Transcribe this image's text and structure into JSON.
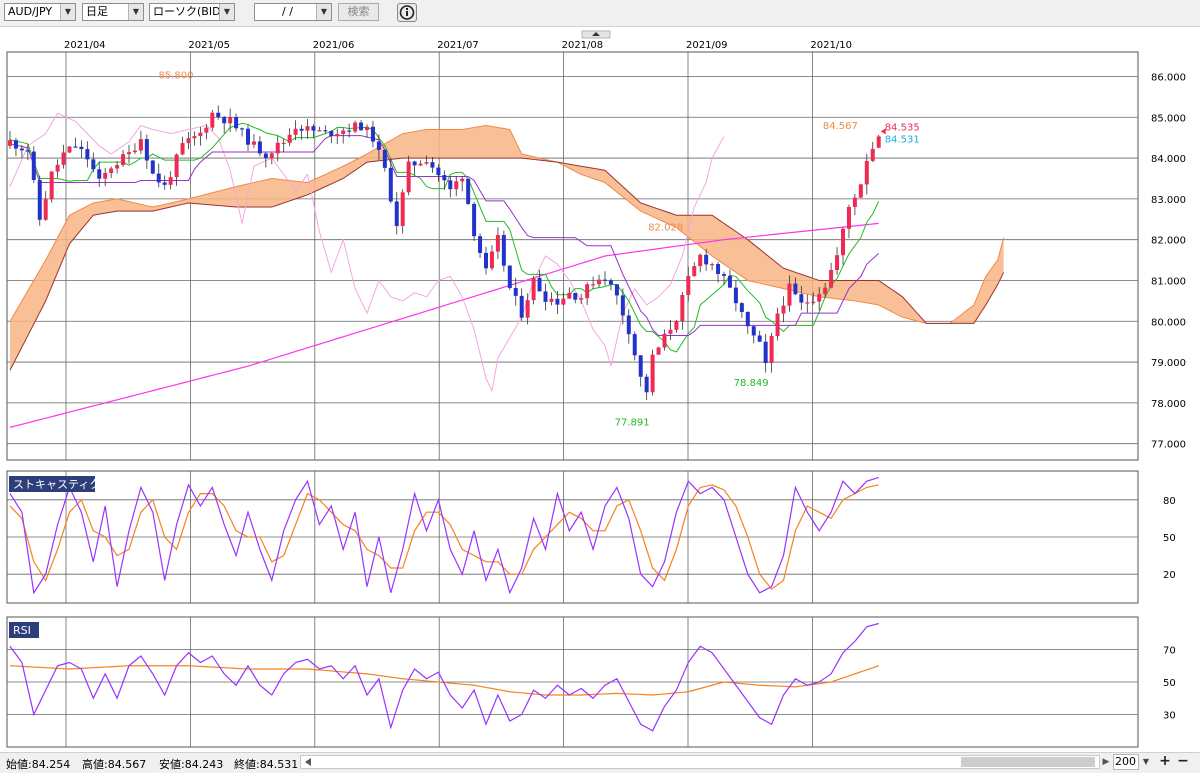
{
  "toolbar": {
    "symbol": "AUD/JPY",
    "timeframe": "日足",
    "chart_kind": "ローソク(BID)",
    "date": "/ /",
    "search_label": "検索",
    "info_icon": "info-icon"
  },
  "status": {
    "open": "始値:84.254",
    "high": "高値:84.567",
    "low": "安値:84.243",
    "close": "終値:84.531",
    "zoom": "200"
  },
  "panels": {
    "stoch_label": "ストキャスティクス",
    "rsi_label": "RSI"
  },
  "colors": {
    "up": "#ee2a55",
    "down": "#2233cc",
    "cloud": "#f8b484",
    "ma200": "#ff33ee",
    "tenkan": "#22bb22",
    "kijun": "#9933cc",
    "chikou": "#f5a6e0",
    "span_a": "#f08a48",
    "span_b": "#993333",
    "stoch_k": "#9933ff",
    "stoch_d": "#f58220"
  },
  "chart_data": {
    "type": "candlestick",
    "x_axis": {
      "labels": [
        "2021/04",
        "2021/05",
        "2021/06",
        "2021/07",
        "2021/08",
        "2021/09",
        "2021/10"
      ]
    },
    "price_axis": {
      "ticks": [
        "86.000",
        "85.000",
        "84.000",
        "83.000",
        "82.000",
        "81.000",
        "80.000",
        "79.000",
        "78.000",
        "77.000"
      ],
      "ylim": [
        76.6,
        86.6
      ]
    },
    "annotations": [
      {
        "text": "85.800",
        "color": "#f08a48",
        "x_index": 31,
        "value": 85.8
      },
      {
        "text": "82.028",
        "color": "#f08a48",
        "x_index": 116,
        "value": 82.03
      },
      {
        "text": "77.891",
        "color": "#22bb22",
        "x_index": 107,
        "value": 77.89
      },
      {
        "text": "78.849",
        "color": "#22bb22",
        "x_index": 127,
        "value": 78.85
      },
      {
        "text": "84.567",
        "color": "#f08a48",
        "x_index": 143,
        "value": 84.567
      },
      {
        "text": "84.535",
        "color": "#ee2a55",
        "x_index": 146,
        "value": 84.535
      },
      {
        "text": "84.531",
        "color": "#22aadd",
        "x_index": 146,
        "value": 84.531
      }
    ],
    "last": {
      "open": 84.254,
      "high": 84.567,
      "low": 84.243,
      "close": 84.531
    },
    "stoch_axis": {
      "ticks": [
        "80",
        "50",
        "20"
      ],
      "ylim": [
        0,
        100
      ]
    },
    "rsi_axis": {
      "ticks": [
        "70",
        "50",
        "30"
      ],
      "ylim": [
        10,
        90
      ]
    },
    "close_waypoints": [
      [
        0,
        84.4
      ],
      [
        3,
        84.2
      ],
      [
        5,
        82.5
      ],
      [
        7,
        83.6
      ],
      [
        9,
        84.1
      ],
      [
        11,
        84.3
      ],
      [
        13,
        84.0
      ],
      [
        15,
        83.4
      ],
      [
        17,
        83.8
      ],
      [
        20,
        84.1
      ],
      [
        22,
        84.5
      ],
      [
        24,
        83.6
      ],
      [
        26,
        83.3
      ],
      [
        29,
        84.3
      ],
      [
        32,
        84.6
      ],
      [
        34,
        85.1
      ],
      [
        37,
        84.9
      ],
      [
        39,
        84.6
      ],
      [
        41,
        84.3
      ],
      [
        43,
        84.1
      ],
      [
        46,
        84.4
      ],
      [
        48,
        84.8
      ],
      [
        50,
        84.7
      ],
      [
        53,
        84.6
      ],
      [
        56,
        84.7
      ],
      [
        59,
        84.8
      ],
      [
        61,
        84.5
      ],
      [
        63,
        83.7
      ],
      [
        65,
        82.4
      ],
      [
        67,
        83.8
      ],
      [
        70,
        84.0
      ],
      [
        72,
        83.6
      ],
      [
        74,
        83.2
      ],
      [
        76,
        83.6
      ],
      [
        78,
        82.2
      ],
      [
        80,
        81.2
      ],
      [
        82,
        82.0
      ],
      [
        84,
        80.8
      ],
      [
        86,
        80.2
      ],
      [
        88,
        81.0
      ],
      [
        90,
        80.6
      ],
      [
        92,
        80.5
      ],
      [
        94,
        80.7
      ],
      [
        96,
        80.6
      ],
      [
        98,
        81.0
      ],
      [
        100,
        81.1
      ],
      [
        102,
        80.6
      ],
      [
        104,
        79.8
      ],
      [
        106,
        78.6
      ],
      [
        107,
        78.3
      ],
      [
        108,
        79.1
      ],
      [
        110,
        79.6
      ],
      [
        112,
        80.1
      ],
      [
        114,
        81.0
      ],
      [
        116,
        81.6
      ],
      [
        118,
        81.4
      ],
      [
        120,
        81.0
      ],
      [
        122,
        80.5
      ],
      [
        124,
        79.8
      ],
      [
        126,
        79.4
      ],
      [
        127,
        78.9
      ],
      [
        129,
        80.2
      ],
      [
        131,
        80.8
      ],
      [
        133,
        80.4
      ],
      [
        135,
        80.6
      ],
      [
        137,
        80.9
      ],
      [
        139,
        81.6
      ],
      [
        141,
        82.8
      ],
      [
        143,
        83.4
      ],
      [
        144,
        84.0
      ],
      [
        146,
        84.531
      ]
    ],
    "ma200_waypoints": [
      [
        0,
        77.4
      ],
      [
        40,
        78.9
      ],
      [
        80,
        80.7
      ],
      [
        100,
        81.6
      ],
      [
        120,
        82.0
      ],
      [
        146,
        82.4
      ]
    ],
    "cloud_a_waypoints": [
      [
        0,
        80.0
      ],
      [
        6,
        81.5
      ],
      [
        10,
        82.6
      ],
      [
        14,
        82.9
      ],
      [
        18,
        83.0
      ],
      [
        24,
        82.8
      ],
      [
        30,
        83.0
      ],
      [
        38,
        83.3
      ],
      [
        44,
        83.5
      ],
      [
        50,
        83.4
      ],
      [
        56,
        83.8
      ],
      [
        60,
        84.1
      ],
      [
        66,
        84.6
      ],
      [
        70,
        84.7
      ],
      [
        76,
        84.7
      ],
      [
        80,
        84.8
      ],
      [
        84,
        84.7
      ],
      [
        86,
        84.1
      ],
      [
        92,
        83.9
      ],
      [
        96,
        83.6
      ],
      [
        100,
        83.4
      ],
      [
        106,
        82.7
      ],
      [
        112,
        82.3
      ],
      [
        118,
        81.6
      ],
      [
        124,
        81.0
      ],
      [
        130,
        80.8
      ],
      [
        136,
        80.6
      ],
      [
        142,
        80.5
      ],
      [
        146,
        80.4
      ],
      [
        150,
        80.1
      ],
      [
        154,
        79.95
      ],
      [
        158,
        79.95
      ],
      [
        162,
        80.4
      ],
      [
        164,
        81.1
      ],
      [
        166,
        81.5
      ],
      [
        167,
        82.05
      ]
    ],
    "cloud_b_waypoints": [
      [
        0,
        78.8
      ],
      [
        6,
        80.5
      ],
      [
        10,
        81.9
      ],
      [
        14,
        82.6
      ],
      [
        18,
        82.7
      ],
      [
        24,
        82.7
      ],
      [
        30,
        82.9
      ],
      [
        38,
        82.8
      ],
      [
        44,
        82.8
      ],
      [
        50,
        83.1
      ],
      [
        56,
        83.5
      ],
      [
        60,
        83.9
      ],
      [
        66,
        84.0
      ],
      [
        70,
        84.0
      ],
      [
        76,
        84.0
      ],
      [
        80,
        84.0
      ],
      [
        84,
        84.0
      ],
      [
        86,
        84.0
      ],
      [
        92,
        83.9
      ],
      [
        96,
        83.8
      ],
      [
        100,
        83.7
      ],
      [
        106,
        82.9
      ],
      [
        112,
        82.6
      ],
      [
        118,
        82.6
      ],
      [
        124,
        82.0
      ],
      [
        130,
        81.3
      ],
      [
        136,
        81.0
      ],
      [
        142,
        81.0
      ],
      [
        146,
        81.0
      ],
      [
        150,
        80.6
      ],
      [
        154,
        79.95
      ],
      [
        158,
        79.95
      ],
      [
        162,
        79.95
      ],
      [
        164,
        80.4
      ],
      [
        166,
        80.9
      ],
      [
        167,
        81.2
      ]
    ],
    "stoch_k_waypoints": [
      [
        0,
        85
      ],
      [
        2,
        70
      ],
      [
        4,
        5
      ],
      [
        6,
        20
      ],
      [
        8,
        60
      ],
      [
        10,
        90
      ],
      [
        12,
        70
      ],
      [
        14,
        30
      ],
      [
        16,
        75
      ],
      [
        18,
        10
      ],
      [
        20,
        55
      ],
      [
        22,
        90
      ],
      [
        24,
        70
      ],
      [
        26,
        15
      ],
      [
        28,
        60
      ],
      [
        30,
        92
      ],
      [
        32,
        75
      ],
      [
        34,
        90
      ],
      [
        36,
        60
      ],
      [
        38,
        35
      ],
      [
        40,
        70
      ],
      [
        42,
        40
      ],
      [
        44,
        15
      ],
      [
        46,
        55
      ],
      [
        48,
        80
      ],
      [
        50,
        95
      ],
      [
        52,
        60
      ],
      [
        54,
        75
      ],
      [
        56,
        40
      ],
      [
        58,
        70
      ],
      [
        60,
        10
      ],
      [
        62,
        50
      ],
      [
        64,
        5
      ],
      [
        66,
        40
      ],
      [
        68,
        85
      ],
      [
        70,
        55
      ],
      [
        72,
        80
      ],
      [
        74,
        40
      ],
      [
        76,
        20
      ],
      [
        78,
        55
      ],
      [
        80,
        15
      ],
      [
        82,
        40
      ],
      [
        84,
        5
      ],
      [
        86,
        25
      ],
      [
        88,
        65
      ],
      [
        90,
        40
      ],
      [
        92,
        85
      ],
      [
        94,
        55
      ],
      [
        96,
        70
      ],
      [
        98,
        40
      ],
      [
        100,
        75
      ],
      [
        102,
        90
      ],
      [
        104,
        65
      ],
      [
        106,
        20
      ],
      [
        108,
        10
      ],
      [
        110,
        30
      ],
      [
        112,
        70
      ],
      [
        114,
        95
      ],
      [
        116,
        85
      ],
      [
        118,
        90
      ],
      [
        120,
        80
      ],
      [
        122,
        50
      ],
      [
        124,
        20
      ],
      [
        126,
        5
      ],
      [
        128,
        10
      ],
      [
        130,
        35
      ],
      [
        132,
        90
      ],
      [
        134,
        70
      ],
      [
        136,
        55
      ],
      [
        138,
        70
      ],
      [
        140,
        95
      ],
      [
        142,
        85
      ],
      [
        144,
        95
      ],
      [
        146,
        98
      ]
    ],
    "stoch_d_waypoints": [
      [
        0,
        75
      ],
      [
        2,
        65
      ],
      [
        4,
        30
      ],
      [
        6,
        15
      ],
      [
        8,
        40
      ],
      [
        10,
        70
      ],
      [
        12,
        80
      ],
      [
        14,
        55
      ],
      [
        16,
        50
      ],
      [
        18,
        35
      ],
      [
        20,
        40
      ],
      [
        22,
        70
      ],
      [
        24,
        80
      ],
      [
        26,
        50
      ],
      [
        28,
        40
      ],
      [
        30,
        70
      ],
      [
        32,
        85
      ],
      [
        34,
        85
      ],
      [
        36,
        75
      ],
      [
        38,
        55
      ],
      [
        40,
        50
      ],
      [
        42,
        50
      ],
      [
        44,
        30
      ],
      [
        46,
        35
      ],
      [
        48,
        60
      ],
      [
        50,
        85
      ],
      [
        52,
        80
      ],
      [
        54,
        70
      ],
      [
        56,
        60
      ],
      [
        58,
        55
      ],
      [
        60,
        40
      ],
      [
        62,
        35
      ],
      [
        64,
        25
      ],
      [
        66,
        25
      ],
      [
        68,
        55
      ],
      [
        70,
        70
      ],
      [
        72,
        70
      ],
      [
        74,
        60
      ],
      [
        76,
        40
      ],
      [
        78,
        35
      ],
      [
        80,
        30
      ],
      [
        82,
        30
      ],
      [
        84,
        20
      ],
      [
        86,
        20
      ],
      [
        88,
        40
      ],
      [
        90,
        50
      ],
      [
        92,
        60
      ],
      [
        94,
        70
      ],
      [
        96,
        65
      ],
      [
        98,
        55
      ],
      [
        100,
        55
      ],
      [
        102,
        75
      ],
      [
        104,
        80
      ],
      [
        106,
        55
      ],
      [
        108,
        25
      ],
      [
        110,
        15
      ],
      [
        112,
        40
      ],
      [
        114,
        75
      ],
      [
        116,
        90
      ],
      [
        118,
        92
      ],
      [
        120,
        88
      ],
      [
        122,
        75
      ],
      [
        124,
        50
      ],
      [
        126,
        20
      ],
      [
        128,
        8
      ],
      [
        130,
        15
      ],
      [
        132,
        55
      ],
      [
        134,
        75
      ],
      [
        136,
        70
      ],
      [
        138,
        65
      ],
      [
        140,
        80
      ],
      [
        142,
        85
      ],
      [
        144,
        90
      ],
      [
        146,
        92
      ]
    ],
    "rsi_waypoints": [
      [
        0,
        72
      ],
      [
        2,
        62
      ],
      [
        4,
        30
      ],
      [
        6,
        45
      ],
      [
        8,
        60
      ],
      [
        10,
        62
      ],
      [
        12,
        58
      ],
      [
        14,
        40
      ],
      [
        16,
        55
      ],
      [
        18,
        40
      ],
      [
        20,
        60
      ],
      [
        22,
        66
      ],
      [
        24,
        55
      ],
      [
        26,
        42
      ],
      [
        28,
        60
      ],
      [
        30,
        68
      ],
      [
        32,
        62
      ],
      [
        34,
        66
      ],
      [
        36,
        55
      ],
      [
        38,
        48
      ],
      [
        40,
        60
      ],
      [
        42,
        48
      ],
      [
        44,
        42
      ],
      [
        46,
        55
      ],
      [
        48,
        62
      ],
      [
        50,
        64
      ],
      [
        52,
        58
      ],
      [
        54,
        60
      ],
      [
        56,
        52
      ],
      [
        58,
        60
      ],
      [
        60,
        42
      ],
      [
        62,
        52
      ],
      [
        64,
        22
      ],
      [
        66,
        45
      ],
      [
        68,
        58
      ],
      [
        70,
        52
      ],
      [
        72,
        56
      ],
      [
        74,
        42
      ],
      [
        76,
        34
      ],
      [
        78,
        45
      ],
      [
        80,
        24
      ],
      [
        82,
        42
      ],
      [
        84,
        26
      ],
      [
        86,
        30
      ],
      [
        88,
        45
      ],
      [
        90,
        40
      ],
      [
        92,
        48
      ],
      [
        94,
        42
      ],
      [
        96,
        46
      ],
      [
        98,
        40
      ],
      [
        100,
        48
      ],
      [
        102,
        52
      ],
      [
        104,
        38
      ],
      [
        106,
        24
      ],
      [
        108,
        20
      ],
      [
        110,
        35
      ],
      [
        112,
        45
      ],
      [
        114,
        62
      ],
      [
        116,
        72
      ],
      [
        118,
        68
      ],
      [
        120,
        58
      ],
      [
        122,
        48
      ],
      [
        124,
        38
      ],
      [
        126,
        28
      ],
      [
        128,
        24
      ],
      [
        130,
        42
      ],
      [
        132,
        52
      ],
      [
        134,
        48
      ],
      [
        136,
        50
      ],
      [
        138,
        55
      ],
      [
        140,
        68
      ],
      [
        142,
        75
      ],
      [
        144,
        84
      ],
      [
        146,
        86
      ]
    ],
    "rsi_ma_waypoints": [
      [
        0,
        60
      ],
      [
        10,
        58
      ],
      [
        20,
        60
      ],
      [
        30,
        60
      ],
      [
        40,
        58
      ],
      [
        50,
        58
      ],
      [
        60,
        55
      ],
      [
        66,
        52
      ],
      [
        72,
        50
      ],
      [
        78,
        48
      ],
      [
        84,
        44
      ],
      [
        90,
        42
      ],
      [
        96,
        42
      ],
      [
        102,
        43
      ],
      [
        108,
        42
      ],
      [
        114,
        44
      ],
      [
        120,
        50
      ],
      [
        126,
        48
      ],
      [
        132,
        47
      ],
      [
        138,
        50
      ],
      [
        142,
        55
      ],
      [
        146,
        60
      ]
    ]
  }
}
